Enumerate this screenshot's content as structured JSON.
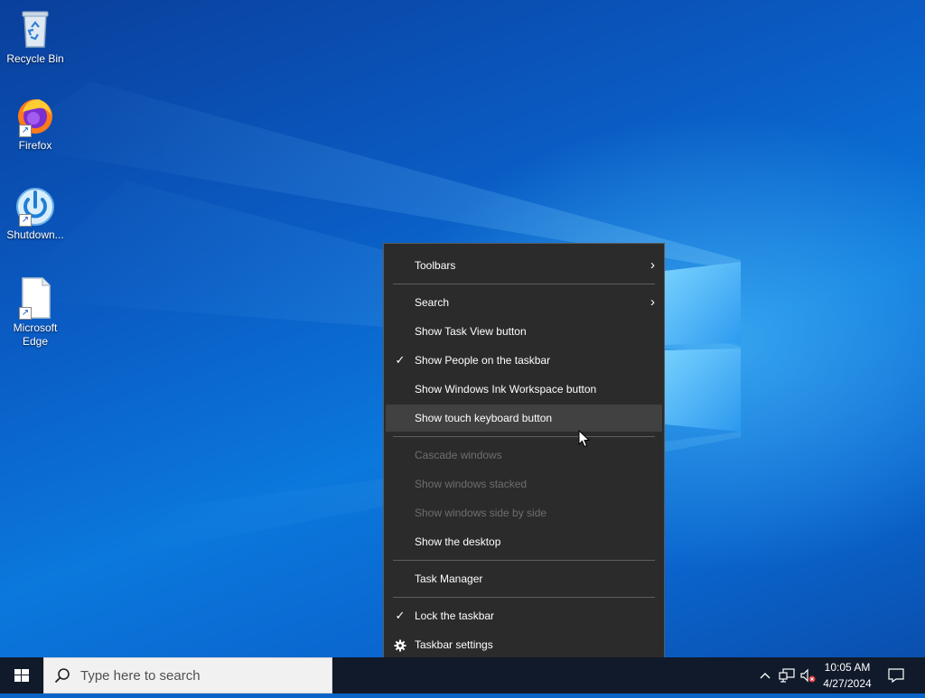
{
  "desktop": {
    "icons": [
      {
        "label": "Recycle Bin",
        "icon": "recycle-bin-icon"
      },
      {
        "label": "Firefox",
        "icon": "firefox-icon"
      },
      {
        "label": "Shutdown...",
        "icon": "power-icon"
      },
      {
        "label_line1": "Microsoft",
        "label_line2": "Edge",
        "icon": "document-icon"
      }
    ]
  },
  "context_menu": {
    "items": [
      {
        "label": "Toolbars",
        "submenu": true,
        "checked": false,
        "enabled": true
      },
      {
        "label": "Search",
        "submenu": true,
        "checked": false,
        "enabled": true
      },
      {
        "label": "Show Task View button",
        "checked": false,
        "enabled": true
      },
      {
        "label": "Show People on the taskbar",
        "checked": true,
        "enabled": true
      },
      {
        "label": "Show Windows Ink Workspace button",
        "checked": false,
        "enabled": true
      },
      {
        "label": "Show touch keyboard button",
        "checked": false,
        "enabled": true,
        "highlighted": true
      },
      {
        "label": "Cascade windows",
        "checked": false,
        "enabled": false
      },
      {
        "label": "Show windows stacked",
        "checked": false,
        "enabled": false
      },
      {
        "label": "Show windows side by side",
        "checked": false,
        "enabled": false
      },
      {
        "label": "Show the desktop",
        "checked": false,
        "enabled": true
      },
      {
        "label": "Task Manager",
        "checked": false,
        "enabled": true
      },
      {
        "label": "Lock the taskbar",
        "checked": true,
        "enabled": true
      },
      {
        "label": "Taskbar settings",
        "icon": "gear-icon",
        "enabled": true
      }
    ],
    "check_glyph": "✓",
    "submenu_glyph": "›"
  },
  "taskbar": {
    "search_placeholder": "Type here to search",
    "clock_time": "10:05 AM",
    "clock_date": "4/27/2024",
    "tray_icons": [
      "chevron-up-icon",
      "network-icon",
      "volume-muted-icon",
      "notification-icon"
    ]
  },
  "colors": {
    "menu_bg": "#2b2b2b",
    "menu_highlight": "#414141",
    "taskbar_bg": "#101a2a",
    "desktop_blue": "#0a64c8"
  }
}
